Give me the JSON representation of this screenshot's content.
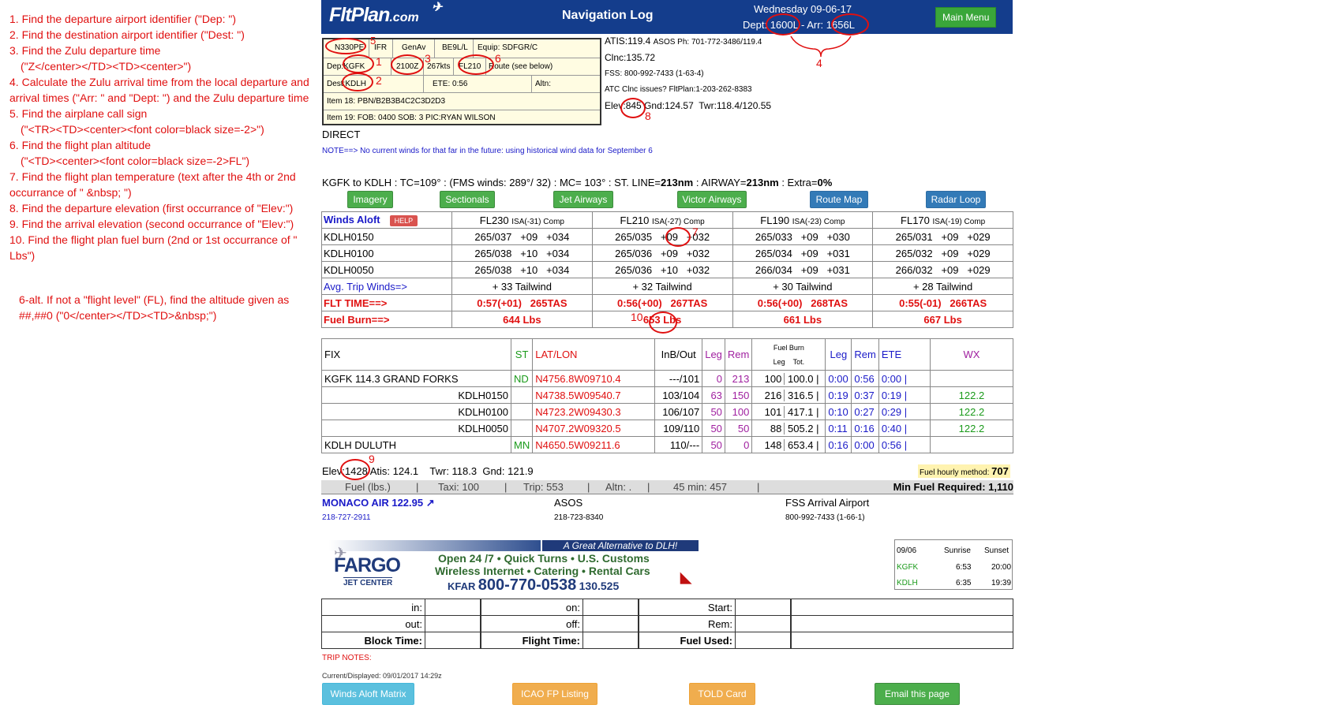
{
  "instructions": [
    {
      "num": "1.",
      "text": "Find the departure airport identifier (\"Dep: \")"
    },
    {
      "num": "2.",
      "text": "Find the destination airport identifier (\"Dest: \")"
    },
    {
      "num": "3.",
      "text": "Find the Zulu departure time",
      "sub": "(\"Z</center></TD><TD><center>\")"
    },
    {
      "num": "4.",
      "text": "Calculate the Zulu arrival time from the local departure and arrival times (\"Arr: \" and \"Dept: \") and the Zulu departure time"
    },
    {
      "num": "5.",
      "text": "Find the airplane call sign",
      "sub": "(\"<TR><TD><center><font color=black size=-2>\")"
    },
    {
      "num": "6.",
      "text": "Find the flight plan altitude",
      "sub": "(\"<TD><center><font color=black size=-2>FL\")"
    },
    {
      "num": "7.",
      "text": "Find the flight plan temperature (text after the 4th or 2nd occurrance of \" &nbsp; \")"
    },
    {
      "num": "8.",
      "text": "Find the departure elevation (first occurrance of \"Elev:\")"
    },
    {
      "num": "9.",
      "text": "Find the arrival elevation (second occurrance of \"Elev:\")"
    },
    {
      "num": "10.",
      "text": "Find the flight plan fuel burn (2nd or 1st occurrance of \" Lbs\")"
    }
  ],
  "alt_instruction": "6-alt. If not a \"flight level\" (FL), find the altitude given as ##,##0 (\"0</center></TD><TD>&nbsp;\")",
  "header": {
    "logo": "FltPlan",
    "logo_suffix": ".com",
    "title": "Navigation Log",
    "date": "Wednesday 09-06-17",
    "dept_label": "Dept:",
    "dept_time": "1600L",
    "arr_label": "- Arr:",
    "arr_time": "1656L",
    "main_menu": "Main Menu"
  },
  "flightplan": {
    "callsign": "N330PE",
    "rules": "IFR",
    "type": "GenAv",
    "aircraft": "BE9L/L",
    "equip": "Equip: SDFGR/C",
    "dep_label": "Dep:",
    "dep": "KGFK",
    "zulu": "2100Z",
    "speed": "267kts",
    "altitude": "FL210",
    "route": "Route (see below)",
    "dest_label": "Dest:",
    "dest": "KDLH",
    "ete": "ETE: 0:56",
    "altn": "Altn:",
    "item18": "Item 18: PBN/B2B3B4C2C3D2D3",
    "item19": "Item 19:  FOB: 0400  SOB: 3  PIC:RYAN WILSON"
  },
  "depinfo": {
    "atis": "ATIS:119.4",
    "asos": "ASOS Ph: 701-772-3486/119.4",
    "clnc": "Clnc:135.72",
    "fss": "FSS: 800-992-7433 (1-63-4)",
    "atc": "ATC Clnc issues? FltPlan:1-203-262-8383",
    "elev_label": "Elev:",
    "elev": "845",
    "gnd": "Gnd:124.57",
    "twr": "Twr:118.4/120.55"
  },
  "route_text": "DIRECT",
  "note": "NOTE==> No current winds for that far in the future: using historical wind data for September 6",
  "summary": {
    "a": "KGFK to KDLH : TC=109° : (FMS winds: 289°/ 32) : MC= 103° : ST. LINE=",
    "b": "213nm",
    "c": " : AIRWAY=",
    "d": "213nm",
    "e": " : Extra=",
    "f": "0%"
  },
  "buttons": {
    "imagery": "Imagery",
    "sectionals": "Sectionals",
    "jet": "Jet Airways",
    "victor": "Victor Airways",
    "routemap": "Route Map",
    "radar": "Radar Loop"
  },
  "winds": {
    "title": "Winds Aloft",
    "help": "HELP",
    "levels": [
      {
        "fl": "FL230",
        "isa": "ISA(-31) Comp"
      },
      {
        "fl": "FL210",
        "isa": "ISA(-27) Comp"
      },
      {
        "fl": "FL190",
        "isa": "ISA(-23) Comp"
      },
      {
        "fl": "FL170",
        "isa": "ISA(-19) Comp"
      }
    ],
    "rows": [
      {
        "name": "KDLH0150",
        "cells": [
          "265/037   +09   +034",
          "265/035   +09   +032",
          "265/033   +09   +030",
          "265/031   +09   +029"
        ]
      },
      {
        "name": "KDLH0100",
        "cells": [
          "265/038   +10   +034",
          "265/036   +09   +032",
          "265/034   +09   +031",
          "265/032   +09   +029"
        ]
      },
      {
        "name": "KDLH0050",
        "cells": [
          "265/038   +10   +034",
          "265/036   +10   +032",
          "266/034   +09   +031",
          "266/032   +09   +029"
        ]
      }
    ],
    "avg_label": "Avg. Trip Winds=>",
    "avg": [
      "+ 33 Tailwind",
      "+ 32 Tailwind",
      "+ 30 Tailwind",
      "+ 28 Tailwind"
    ],
    "flt_label": "FLT TIME==>",
    "flt": [
      "0:57(+01)   265TAS",
      "0:56(+00)   267TAS",
      "0:56(+00)   268TAS",
      "0:55(-01)   266TAS"
    ],
    "fuel_label": "Fuel Burn==>",
    "fuel": [
      "644 Lbs",
      "653 Lbs",
      "661 Lbs",
      "667 Lbs"
    ]
  },
  "fixes": {
    "headers": {
      "fix": "FIX",
      "st": "ST",
      "latlon": "LAT/LON",
      "inb": "InB/Out",
      "leg": "Leg",
      "rem": "Rem",
      "fuelburn": "Fuel Burn",
      "fb_leg": "Leg",
      "fb_tot": "Tot.",
      "tleg": "Leg",
      "trem": "Rem",
      "ete": "ETE",
      "wx": "WX"
    },
    "rows": [
      {
        "fix": "KGFK 114.3 GRAND FORKS",
        "st": "ND",
        "latlon": "N4756.8W09710.4",
        "inb": "---/101",
        "leg": "0",
        "rem": "213",
        "fleg": "100",
        "ftot": "100.0 |",
        "tleg": "0:00",
        "trem": "0:56",
        "ete": "0:00 |",
        "wx": ""
      },
      {
        "fix": "KDLH0150",
        "st": "",
        "latlon": "N4738.5W09540.7",
        "inb": "103/104",
        "leg": "63",
        "rem": "150",
        "fleg": "216",
        "ftot": "316.5 |",
        "tleg": "0:19",
        "trem": "0:37",
        "ete": "0:19 |",
        "wx": "122.2"
      },
      {
        "fix": "KDLH0100",
        "st": "",
        "latlon": "N4723.2W09430.3",
        "inb": "106/107",
        "leg": "50",
        "rem": "100",
        "fleg": "101",
        "ftot": "417.1 |",
        "tleg": "0:10",
        "trem": "0:27",
        "ete": "0:29 |",
        "wx": "122.2"
      },
      {
        "fix": "KDLH0050",
        "st": "",
        "latlon": "N4707.2W09320.5",
        "inb": "109/110",
        "leg": "50",
        "rem": "50",
        "fleg": "88",
        "ftot": "505.2 |",
        "tleg": "0:11",
        "trem": "0:16",
        "ete": "0:40 |",
        "wx": "122.2"
      },
      {
        "fix": "KDLH DULUTH",
        "st": "MN",
        "latlon": "N4650.5W09211.6",
        "inb": "110/---",
        "leg": "50",
        "rem": "0",
        "fleg": "148",
        "ftot": "653.4 |",
        "tleg": "0:16",
        "trem": "0:00",
        "ete": "0:56 |",
        "wx": ""
      }
    ]
  },
  "arrinfo": {
    "elev_label": "Elev:",
    "elev": "1428",
    "rest": "Atis: 124.1    Twr: 118.3  Gnd: 121.9",
    "fuel_method": "Fuel hourly method:",
    "fuel_method_val": "707"
  },
  "fuelbar": {
    "fuel": "Fuel (lbs.)",
    "taxi": "Taxi: 100",
    "trip": "Trip: 553",
    "altn": "Altn: .",
    "min45": "45 min: 457",
    "minreq": "Min Fuel Required: 1,110"
  },
  "contacts": {
    "fbo": "MONACO AIR 122.95",
    "fbo_phone": "218-727-2911",
    "asos": "ASOS",
    "asos_phone": "218-723-8340",
    "fss": "FSS Arrival Airport",
    "fss_phone": "800-992-7433 (1-66-1)"
  },
  "ad": {
    "tag": "A Great Alternative to DLH!",
    "brand": "FARGO",
    "brand_sub": "JET CENTER",
    "line1": "Open 24 /7 • Quick Turns • U.S. Customs",
    "line2": "Wireless Internet • Catering • Rental Cars",
    "kfar": "KFAR",
    "phone": "800-770-0538",
    "freq": "130.525"
  },
  "sun": {
    "date": "09/06",
    "h1": "Sunrise",
    "h2": "Sunset",
    "rows": [
      {
        "apt": "KGFK",
        "rise": "6:53",
        "set": "20:00"
      },
      {
        "apt": "KDLH",
        "rise": "6:35",
        "set": "19:39"
      }
    ]
  },
  "times": {
    "in": "in:",
    "out": "out:",
    "block": "Block Time:",
    "on": "on:",
    "off": "off:",
    "flight": "Flight Time:",
    "start": "Start:",
    "rem": "Rem:",
    "fuelused": "Fuel Used:"
  },
  "trip_notes": "TRIP NOTES:",
  "current": "Current/Displayed: 09/01/2017 14:29z",
  "bottom_buttons": {
    "winds": "Winds Aloft Matrix",
    "icao": "ICAO FP Listing",
    "told": "TOLD Card",
    "email": "Email this page"
  },
  "annotations": [
    "1",
    "2",
    "3",
    "4",
    "5",
    "6",
    "7",
    "8",
    "9",
    "10"
  ],
  "colors": {
    "header": "#143d8c",
    "red": "#e01010",
    "green": "#4cae4c",
    "blue": "#337ab7",
    "orange": "#f0ad4e",
    "cyan": "#5bc0de"
  }
}
